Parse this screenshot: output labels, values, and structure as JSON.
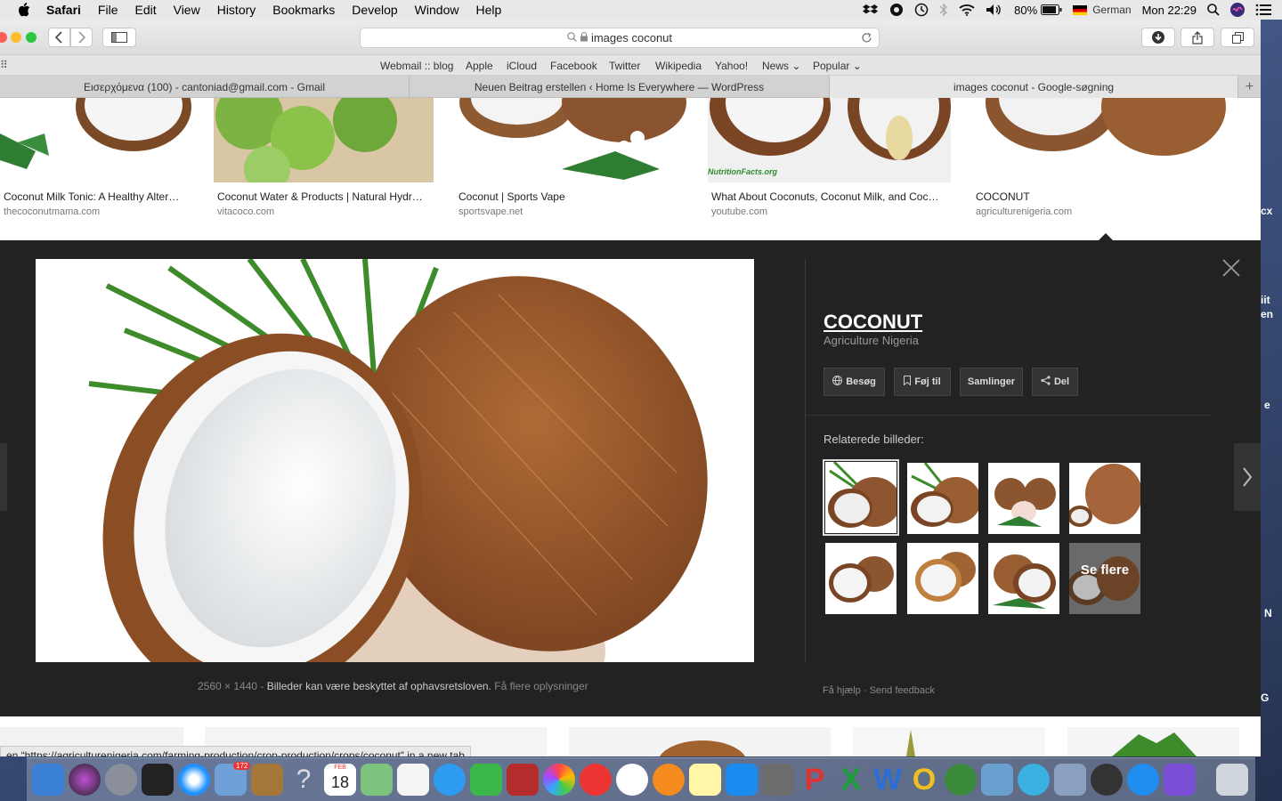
{
  "menubar": {
    "app": "Safari",
    "menus": [
      "File",
      "Edit",
      "View",
      "History",
      "Bookmarks",
      "Develop",
      "Window",
      "Help"
    ],
    "battery": "80%",
    "language": "German",
    "clock": "Mon 22:29"
  },
  "toolbar": {
    "address": "images coconut"
  },
  "bookmarks": [
    "Webmail :: blog",
    "Apple",
    "iCloud",
    "Facebook",
    "Twitter",
    "Wikipedia",
    "Yahoo!",
    "News",
    "Popular"
  ],
  "tabs": [
    "Εισερχόμενα (100) - cantoniad@gmail.com - Gmail",
    "Neuen Beitrag erstellen ‹ Home Is Everywhere — WordPress",
    "images coconut - Google-søgning"
  ],
  "results": [
    {
      "caption": "Coconut Milk Tonic: A Healthy Alter…",
      "source": "thecoconutmama.com"
    },
    {
      "caption": "Coconut Water & Products | Natural Hydr…",
      "source": "vitacoco.com"
    },
    {
      "caption": "Coconut | Sports Vape",
      "source": "sportsvape.net"
    },
    {
      "caption": "What About Coconuts, Coconut Milk, and Coc…",
      "source": "youtube.com"
    },
    {
      "caption": "COCONUT",
      "source": "agriculturenigeria.com"
    }
  ],
  "panel": {
    "title": "COCONUT",
    "site": "Agriculture Nigeria",
    "buttons": [
      "Besøg",
      "Føj til",
      "Samlinger",
      "Del"
    ],
    "related_label": "Relaterede billeder:",
    "see_more": "Se flere",
    "dimensions": "2560 × 1440",
    "copyright": "Billeder kan være beskyttet af ophavsretsloven.",
    "more_info": "Få flere oplysninger",
    "help": "Få hjælp",
    "feedback": "Send feedback",
    "watermark": "NutritionFacts.org"
  },
  "status": "en “https://agriculturenigeria.com/farming-production/crop-production/crops/coconut” in a new tab",
  "desktop_fragments": [
    "cx",
    "iit",
    "en",
    "e",
    "N",
    "G"
  ],
  "dock": {
    "mail_badge": "172",
    "calendar_day": "18",
    "calendar_month": "FEB"
  }
}
